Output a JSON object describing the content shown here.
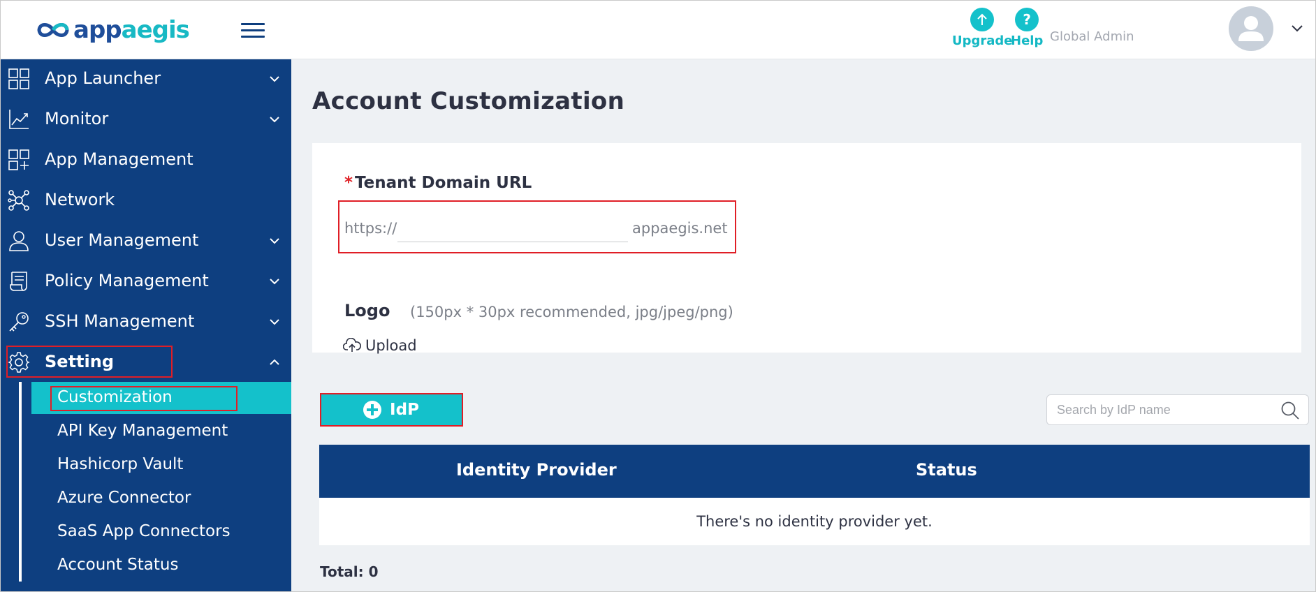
{
  "header": {
    "logo": {
      "part1": "app",
      "part2": "aegis"
    },
    "upgrade_label": "Upgrade",
    "upgrade_icon": "arrow-up-icon",
    "help_label": "Help",
    "help_glyph": "?",
    "role_label": "Global Admin"
  },
  "sidebar": {
    "items": [
      {
        "label": "App Launcher",
        "icon": "grid-icon",
        "expandable": true
      },
      {
        "label": "Monitor",
        "icon": "chart-icon",
        "expandable": true
      },
      {
        "label": "App Management",
        "icon": "apps-plus-icon",
        "expandable": false
      },
      {
        "label": "Network",
        "icon": "network-icon",
        "expandable": false
      },
      {
        "label": "User Management",
        "icon": "user-icon",
        "expandable": true
      },
      {
        "label": "Policy Management",
        "icon": "policy-icon",
        "expandable": true
      },
      {
        "label": "SSH Management",
        "icon": "key-icon",
        "expandable": true
      },
      {
        "label": "Setting",
        "icon": "gear-icon",
        "expandable": true,
        "expanded": true
      }
    ],
    "sub_items": [
      {
        "label": "Customization",
        "active": true
      },
      {
        "label": "API Key Management"
      },
      {
        "label": "Hashicorp Vault"
      },
      {
        "label": "Azure Connector"
      },
      {
        "label": "SaaS App Connectors"
      },
      {
        "label": "Account Status"
      }
    ]
  },
  "main": {
    "title": "Account Customization",
    "tenant": {
      "required_mark": "*",
      "label": "Tenant Domain URL",
      "prefix": "https://",
      "value": "",
      "suffix": "appaegis.net"
    },
    "logo": {
      "label": "Logo",
      "hint": "(150px * 30px recommended, jpg/jpeg/png)",
      "upload_label": "Upload"
    },
    "add_idp_label": "IdP",
    "search": {
      "placeholder": "Search by IdP name",
      "value": ""
    },
    "table": {
      "columns": [
        "Identity Provider",
        "Status"
      ],
      "empty_text": "There's no identity provider yet.",
      "rows": []
    },
    "total_label": "Total: 0"
  },
  "colors": {
    "navy": "#0e3f80",
    "teal": "#14c1cb",
    "highlight": "#e01e26",
    "page_bg": "#eef1f4"
  }
}
